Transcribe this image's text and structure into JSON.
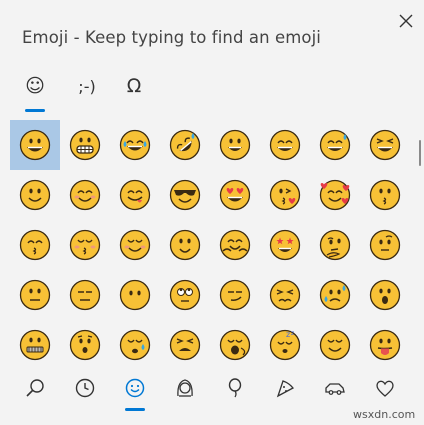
{
  "window": {
    "title": "Emoji - Keep typing to find an emoji"
  },
  "tabs": [
    {
      "name": "emoji",
      "glyph": "☺",
      "active": true
    },
    {
      "name": "kaomoji",
      "glyph": ";-)",
      "active": false
    },
    {
      "name": "symbols",
      "glyph": "Ω",
      "active": false
    }
  ],
  "colors": {
    "accent": "#0078d4",
    "selected_bg": "#aac8e6",
    "face": "#f7c136",
    "face_outline": "#3a2a12",
    "tear": "#3aa6e0",
    "heart": "#e63b46",
    "tongue": "#e8534f",
    "blush": "#f09a7a"
  },
  "emoji_grid": [
    [
      "grinning",
      "grimacing",
      "joy",
      "rolling-on-floor-laughing",
      "smiley",
      "smile",
      "sweat-smile",
      "laughing"
    ],
    [
      "slightly-smiling",
      "blush",
      "yum",
      "sunglasses",
      "heart-eyes",
      "kissing-heart",
      "smiling-face-with-hearts",
      "kissing"
    ],
    [
      "kissing-smiling-eyes",
      "kissing-closed-eyes",
      "relaxed",
      "slightly-smiling-face",
      "hugging",
      "star-struck",
      "thinking",
      "face-with-raised-eyebrow"
    ],
    [
      "neutral",
      "expressionless",
      "no-mouth",
      "rolling-eyes",
      "smirk",
      "persevere",
      "disappointed-relieved",
      "open-mouth"
    ],
    [
      "zipper-mouth",
      "hushed",
      "sleepy",
      "tired",
      "yawning",
      "sleeping",
      "relieved",
      "stuck-out-tongue"
    ]
  ],
  "selected_emoji": "grinning",
  "categories": [
    {
      "name": "search",
      "icon": "search-icon",
      "active": false
    },
    {
      "name": "recently-used",
      "icon": "clock-icon",
      "active": false
    },
    {
      "name": "smileys-and-animals",
      "icon": "smiley-icon",
      "active": true
    },
    {
      "name": "people",
      "icon": "person-icon",
      "active": false
    },
    {
      "name": "celebrations-and-objects",
      "icon": "balloon-icon",
      "active": false
    },
    {
      "name": "food-and-plants",
      "icon": "pizza-icon",
      "active": false
    },
    {
      "name": "transportation-and-places",
      "icon": "car-icon",
      "active": false
    },
    {
      "name": "symbols",
      "icon": "heart-icon",
      "active": false
    }
  ],
  "watermark": "wsxdn.com"
}
